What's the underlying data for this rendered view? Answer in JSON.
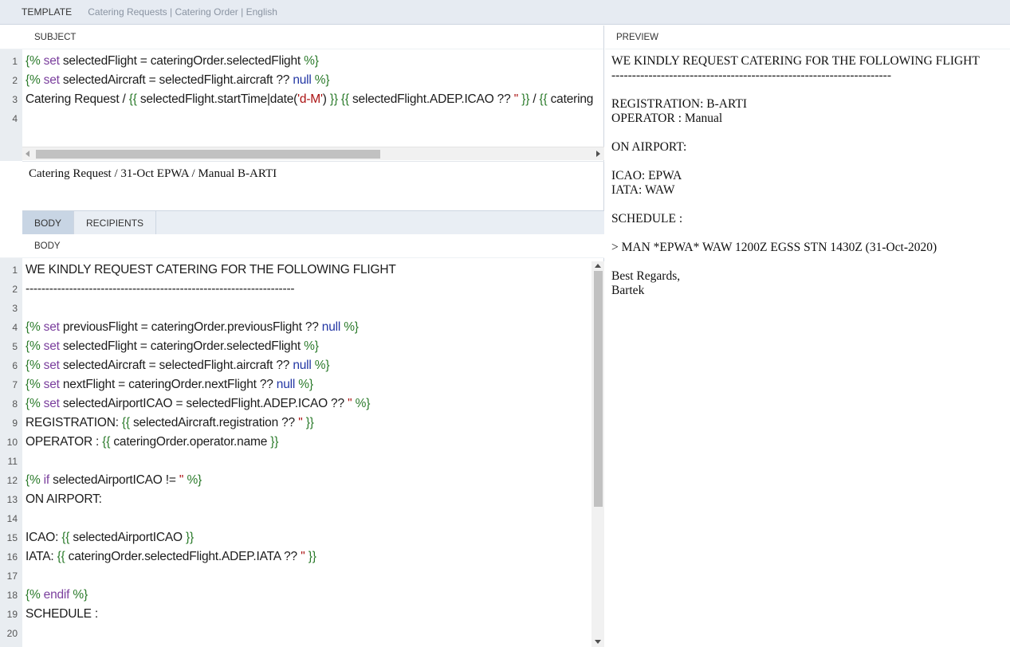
{
  "topbar": {
    "template_label": "TEMPLATE",
    "breadcrumb": "Catering Requests | Catering Order | English"
  },
  "subject": {
    "header": "SUBJECT",
    "preview": "Catering Request / 31-Oct EPWA / Manual B-ARTI"
  },
  "tabs": {
    "body": "BODY",
    "recipients": "RECIPIENTS"
  },
  "body": {
    "header": "BODY"
  },
  "preview": {
    "header": "PREVIEW",
    "text": "WE KINDLY REQUEST CATERING FOR THE FOLLOWING FLIGHT\n--------------------------------------------------------------------\n\nREGISTRATION: B-ARTI\nOPERATOR : Manual\n\nON AIRPORT:\n\nICAO: EPWA\nIATA: WAW\n\nSCHEDULE :\n\n> MAN *EPWA* WAW 1200Z EGSS STN 1430Z (31-Oct-2020)\n\nBest Regards,\nBartek"
  }
}
